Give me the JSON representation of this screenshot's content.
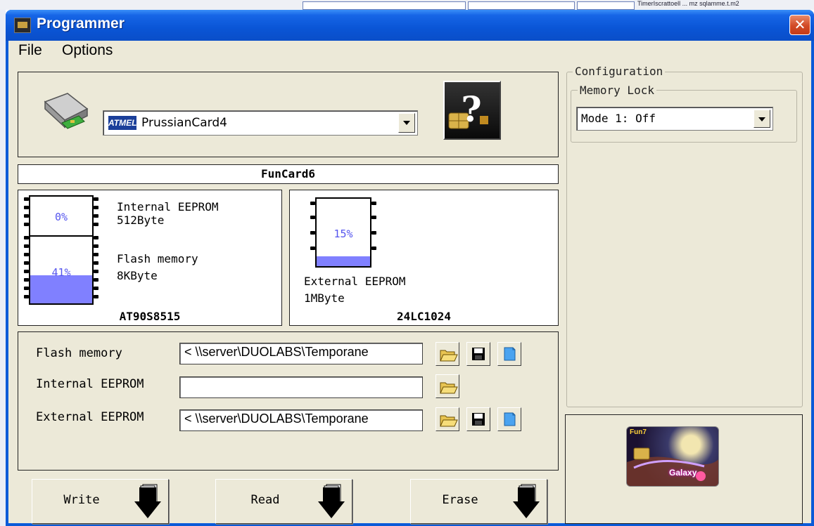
{
  "window": {
    "title": "Programmer",
    "close_symbol": "✕"
  },
  "background": {
    "snippet": "TimerIscrattoell ... mz sqlamme.t.m2"
  },
  "menu": {
    "file": "File",
    "options": "Options"
  },
  "card_selector": {
    "brand": "ATMEL",
    "selected": "PrussianCard4"
  },
  "card_name": "FunCard6",
  "chip_main": {
    "name": "AT90S8515",
    "internal_eeprom": {
      "label": "Internal EEPROM",
      "size": "512Byte",
      "percent_text": "0%",
      "percent": 0
    },
    "flash": {
      "label": "Flash memory",
      "size": "8KByte",
      "percent_text": "41%",
      "percent": 41
    }
  },
  "chip_ext": {
    "name": "24LC1024",
    "label": "External EEPROM",
    "size": "1MByte",
    "percent_text": "15%",
    "percent": 15
  },
  "files": {
    "flash": {
      "label": "Flash memory",
      "value": "< \\\\server\\DUOLABS\\Temporane"
    },
    "internal": {
      "label": "Internal EEPROM",
      "value": ""
    },
    "external": {
      "label": "External EEPROM",
      "value": "< \\\\server\\DUOLABS\\Temporane"
    }
  },
  "actions": {
    "write": "Write",
    "read": "Read",
    "erase": "Erase"
  },
  "configuration": {
    "title": "Configuration",
    "memory_lock": {
      "title": "Memory Lock",
      "selected": "Mode 1: Off"
    }
  },
  "card_image": {
    "text": "Galaxy",
    "corner": "Fun7"
  },
  "colors": {
    "title_blue": "#0a55d6",
    "fill_purple": "#8080ff",
    "percent_text": "#5555ee",
    "panel_bg": "#ece9d8"
  }
}
